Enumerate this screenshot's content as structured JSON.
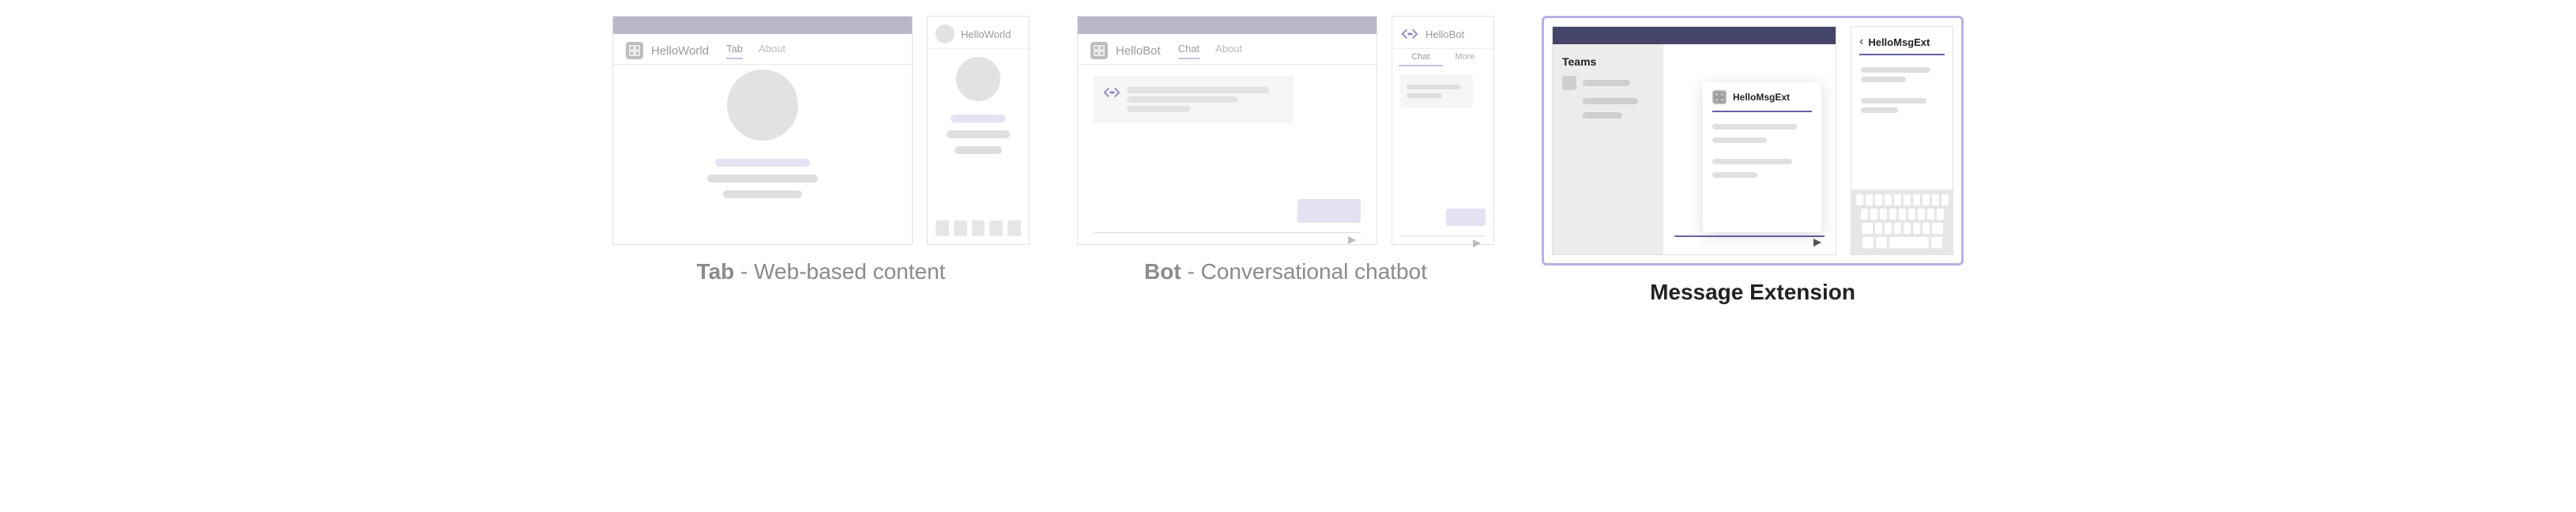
{
  "panels": {
    "tab": {
      "caption_bold": "Tab",
      "caption_rest": " - Web-based content",
      "desktop": {
        "app_name": "HelloWorld",
        "tabs": [
          "Tab",
          "About"
        ],
        "active_tab": "Tab"
      },
      "mobile": {
        "title": "HelloWorld"
      }
    },
    "bot": {
      "caption_bold": "Bot",
      "caption_rest": " - Conversational chatbot",
      "desktop": {
        "app_name": "HelloBot",
        "tabs": [
          "Chat",
          "About"
        ],
        "active_tab": "Chat"
      },
      "mobile": {
        "title": "HelloBot",
        "tabs": [
          "Chat",
          "More"
        ],
        "active_tab": "Chat"
      }
    },
    "msgext": {
      "caption_bold": "Message Extension",
      "caption_rest": "",
      "desktop": {
        "sidebar_title": "Teams",
        "popup_title": "HelloMsgExt"
      },
      "mobile": {
        "title": "HelloMsgExt"
      }
    }
  }
}
